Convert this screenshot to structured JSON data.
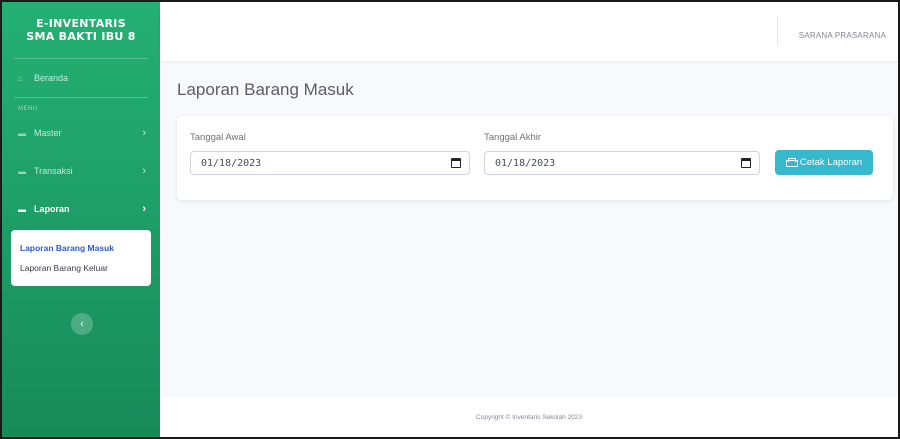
{
  "brand": {
    "line1": "E-INVENTARIS",
    "line2": "SMA BAKTI IBU 8"
  },
  "sidebar": {
    "dashboard": {
      "icon": "home-icon",
      "label": "Beranda"
    },
    "menu_heading": "MENU",
    "items": [
      {
        "icon": "folder-icon",
        "label": "Master",
        "chevron": "›"
      },
      {
        "icon": "folder-icon",
        "label": "Transaksi",
        "chevron": "›"
      },
      {
        "icon": "folder-icon",
        "label": "Laporan",
        "chevron": "›",
        "active": true
      }
    ],
    "submenu": [
      {
        "label": "Laporan Barang Masuk",
        "active": true
      },
      {
        "label": "Laporan Barang Keluar",
        "active": false
      }
    ],
    "toggle_icon": "‹"
  },
  "topbar": {
    "user_name": "SARANA PRASARANA"
  },
  "page": {
    "title": "Laporan Barang Masuk"
  },
  "form": {
    "start_label": "Tanggal Awal",
    "start_value": "01/18/2023",
    "end_label": "Tanggal Akhir",
    "end_value": "01/18/2023",
    "print_label": "Cetak Laporan",
    "print_icon": "printer-icon"
  },
  "footer": {
    "text": "Copyright © Inventaris Sekolah 2023"
  },
  "colors": {
    "sidebar_green": "#1d9c66",
    "button_info": "#36b9cc",
    "active_link": "#2e59d9"
  }
}
